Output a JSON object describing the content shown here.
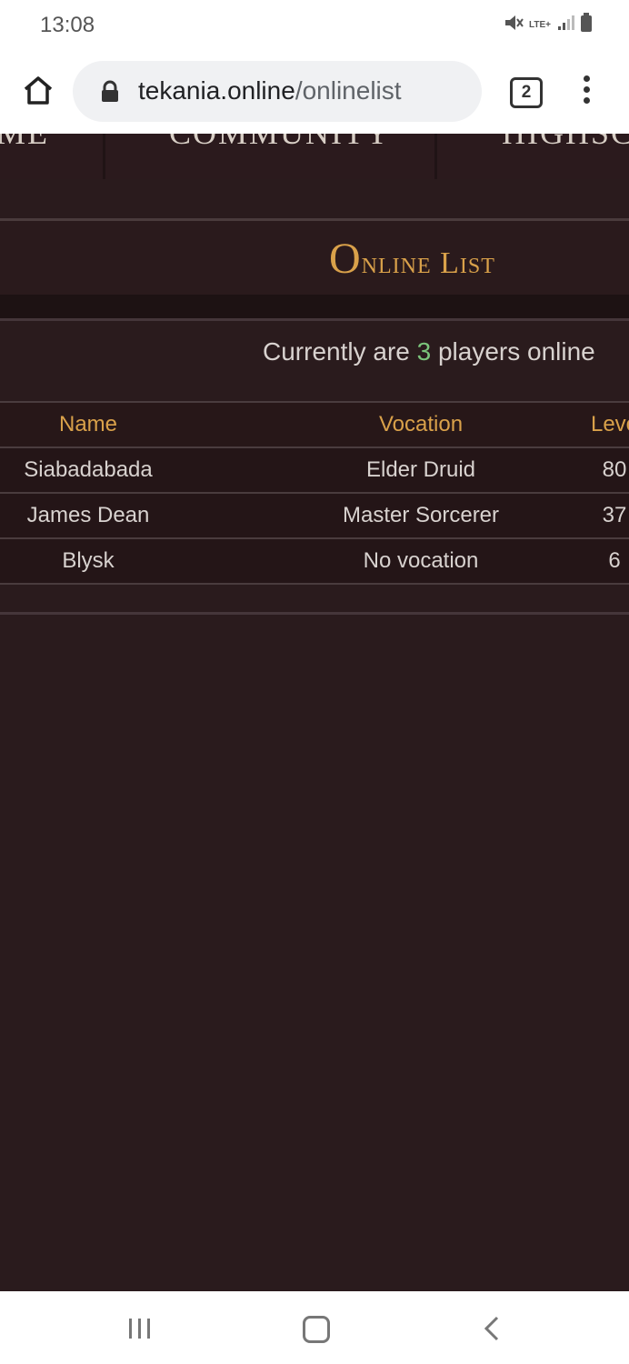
{
  "status_bar": {
    "time": "13:08",
    "network": "LTE+"
  },
  "browser": {
    "url_host": "tekania.online",
    "url_path": "/onlinelist",
    "tab_count": "2"
  },
  "site_nav": {
    "items": [
      "ME",
      "COMMUNITY",
      "HIGHSCO"
    ]
  },
  "page": {
    "title": "Online List",
    "summary_prefix": "Currently are ",
    "player_count": "3",
    "summary_suffix": " players online"
  },
  "table": {
    "headers": {
      "name": "Name",
      "vocation": "Vocation",
      "level": "Leve"
    },
    "rows": [
      {
        "name": "Siabadabada",
        "vocation": "Elder Druid",
        "level": "80"
      },
      {
        "name": "James Dean",
        "vocation": "Master Sorcerer",
        "level": "37"
      },
      {
        "name": "Blysk",
        "vocation": "No vocation",
        "level": "6"
      }
    ]
  },
  "colors": {
    "accent_gold": "#d9a14a",
    "count_green": "#7bc47b",
    "background": "#2a1b1d"
  },
  "icons": [
    "home-icon",
    "lock-icon",
    "tabs-icon",
    "more-vert-icon",
    "mute-icon",
    "signal-icon",
    "battery-icon",
    "recent-apps-icon",
    "system-home-icon",
    "back-icon"
  ]
}
